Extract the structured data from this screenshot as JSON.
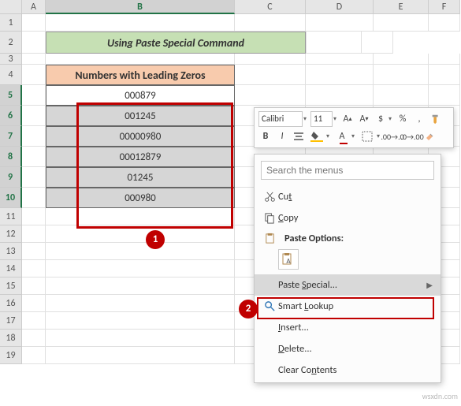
{
  "columns": [
    "A",
    "B",
    "C",
    "D",
    "E",
    "F"
  ],
  "title": "Using Paste Special Command",
  "table_header": "Numbers with Leading Zeros",
  "data": [
    "000879",
    "001245",
    "00000980",
    "00012879",
    "01245",
    "000980"
  ],
  "badges": {
    "one": "1",
    "two": "2"
  },
  "mini": {
    "font": "Calibri",
    "size": "11",
    "bold": "B",
    "italic": "I"
  },
  "menu": {
    "search_placeholder": "Search the menus",
    "cut": "Cut",
    "copy": "Copy",
    "paste_options": "Paste Options:",
    "paste_special": "Paste Special...",
    "smart_lookup": "Smart Lookup",
    "insert": "Insert...",
    "delete": "Delete...",
    "clear": "Clear Contents"
  },
  "watermark": "wsxdn.com",
  "rows": [
    "1",
    "2",
    "3",
    "4",
    "5",
    "6",
    "7",
    "8",
    "9",
    "10",
    "11",
    "12",
    "13",
    "14",
    "15",
    "16",
    "17",
    "18",
    "19"
  ]
}
